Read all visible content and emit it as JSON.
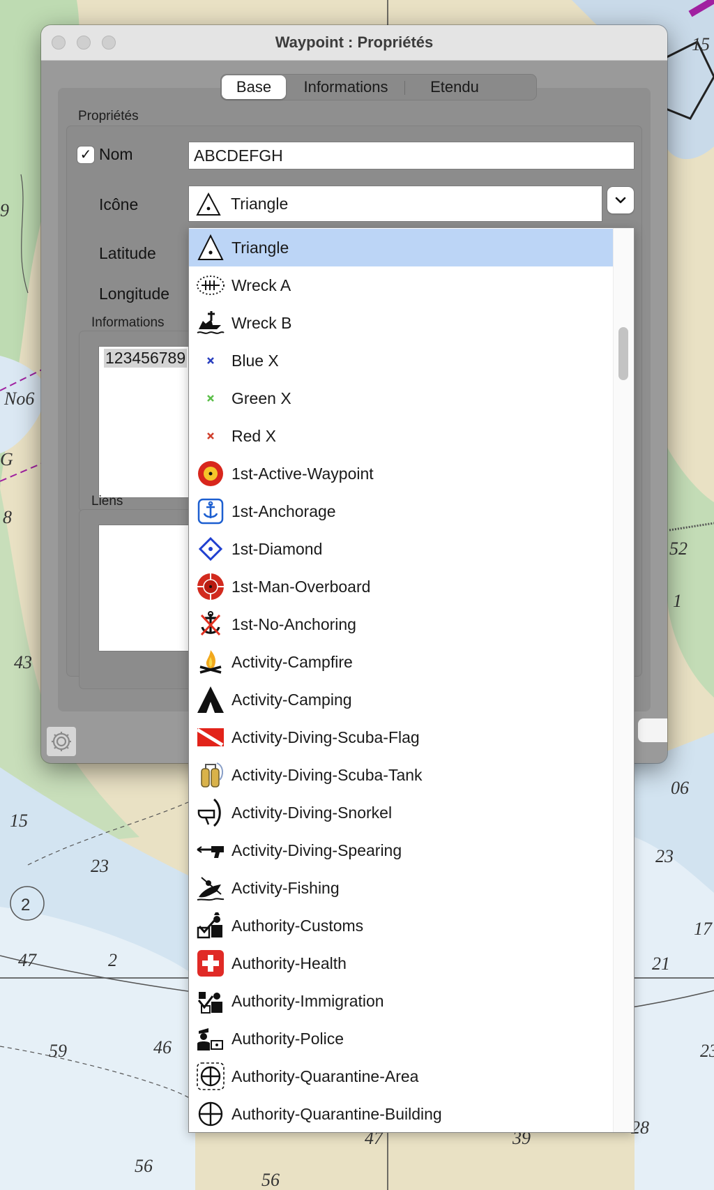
{
  "window": {
    "title": "Waypoint : Propriétés"
  },
  "tabs": [
    {
      "label": "Base",
      "active": true
    },
    {
      "label": "Informations",
      "active": false
    },
    {
      "label": "Etendu",
      "active": false
    }
  ],
  "properties": {
    "section_title": "Propriétés",
    "name_label": "Nom",
    "name_checked": true,
    "name_value": "ABCDEFGH",
    "icon_label": "Icône",
    "icon_value": "Triangle",
    "latitude_label": "Latitude",
    "longitude_label": "Longitude"
  },
  "informations": {
    "section_title": "Informations",
    "text": "123456789"
  },
  "links": {
    "section_title": "Liens"
  },
  "checkmark": "✓",
  "icon_dropdown": {
    "selected": "Triangle",
    "selected_color": "#bcd5f6",
    "options": [
      {
        "label": "Triangle",
        "icon": "triangle-icon"
      },
      {
        "label": "Wreck A",
        "icon": "wreck-a-icon"
      },
      {
        "label": "Wreck B",
        "icon": "wreck-b-icon"
      },
      {
        "label": "Blue X",
        "icon": "blue-x-icon"
      },
      {
        "label": "Green X",
        "icon": "green-x-icon"
      },
      {
        "label": "Red X",
        "icon": "red-x-icon"
      },
      {
        "label": "1st-Active-Waypoint",
        "icon": "active-waypoint-icon"
      },
      {
        "label": "1st-Anchorage",
        "icon": "anchorage-icon"
      },
      {
        "label": "1st-Diamond",
        "icon": "diamond-icon"
      },
      {
        "label": "1st-Man-Overboard",
        "icon": "man-overboard-icon"
      },
      {
        "label": "1st-No-Anchoring",
        "icon": "no-anchoring-icon"
      },
      {
        "label": "Activity-Campfire",
        "icon": "campfire-icon"
      },
      {
        "label": "Activity-Camping",
        "icon": "camping-icon"
      },
      {
        "label": "Activity-Diving-Scuba-Flag",
        "icon": "scuba-flag-icon"
      },
      {
        "label": "Activity-Diving-Scuba-Tank",
        "icon": "scuba-tank-icon"
      },
      {
        "label": "Activity-Diving-Snorkel",
        "icon": "snorkel-icon"
      },
      {
        "label": "Activity-Diving-Spearing",
        "icon": "spearing-icon"
      },
      {
        "label": "Activity-Fishing",
        "icon": "fishing-icon"
      },
      {
        "label": "Authority-Customs",
        "icon": "customs-icon"
      },
      {
        "label": "Authority-Health",
        "icon": "health-icon"
      },
      {
        "label": "Authority-Immigration",
        "icon": "immigration-icon"
      },
      {
        "label": "Authority-Police",
        "icon": "police-icon"
      },
      {
        "label": "Authority-Quarantine-Area",
        "icon": "quarantine-area-icon"
      },
      {
        "label": "Authority-Quarantine-Building",
        "icon": "quarantine-building-icon"
      }
    ]
  },
  "map_labels": [
    "No6",
    "G",
    "9",
    "8",
    "43",
    "15",
    "23",
    "2",
    "47",
    "2",
    "59",
    "46",
    "56",
    "56",
    "47",
    "39",
    "28",
    "21",
    "17",
    "23",
    "06",
    "1",
    "52",
    "15",
    "23"
  ]
}
